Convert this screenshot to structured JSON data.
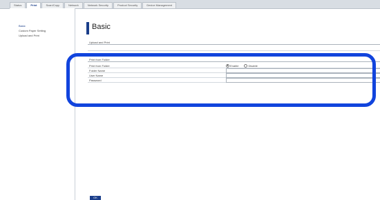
{
  "tabs": [
    "Status",
    "Print",
    "Scan/Copy",
    "Network",
    "Network Security",
    "Product Security",
    "Device Management"
  ],
  "active_tab": "Print",
  "sidebar": {
    "items": [
      "Basic",
      "Custom Paper Setting",
      "Upload and Print"
    ],
    "active": "Basic"
  },
  "page_title": "Basic",
  "sections": {
    "upload_and_print": "Upload and Print",
    "print_from_folder": "Print from Folder"
  },
  "fields": {
    "print_from_folder": "Print from Folder",
    "enable": "Enable",
    "disable": "Disable",
    "folder_name": "Folder Name",
    "folder_name_value": "",
    "user_name": "User Name",
    "user_name_value": "",
    "password": "Password",
    "password_value": ""
  },
  "ok_label": "OK",
  "colors": {
    "accent": "#1a3e8a",
    "highlight": "#1144dd"
  }
}
